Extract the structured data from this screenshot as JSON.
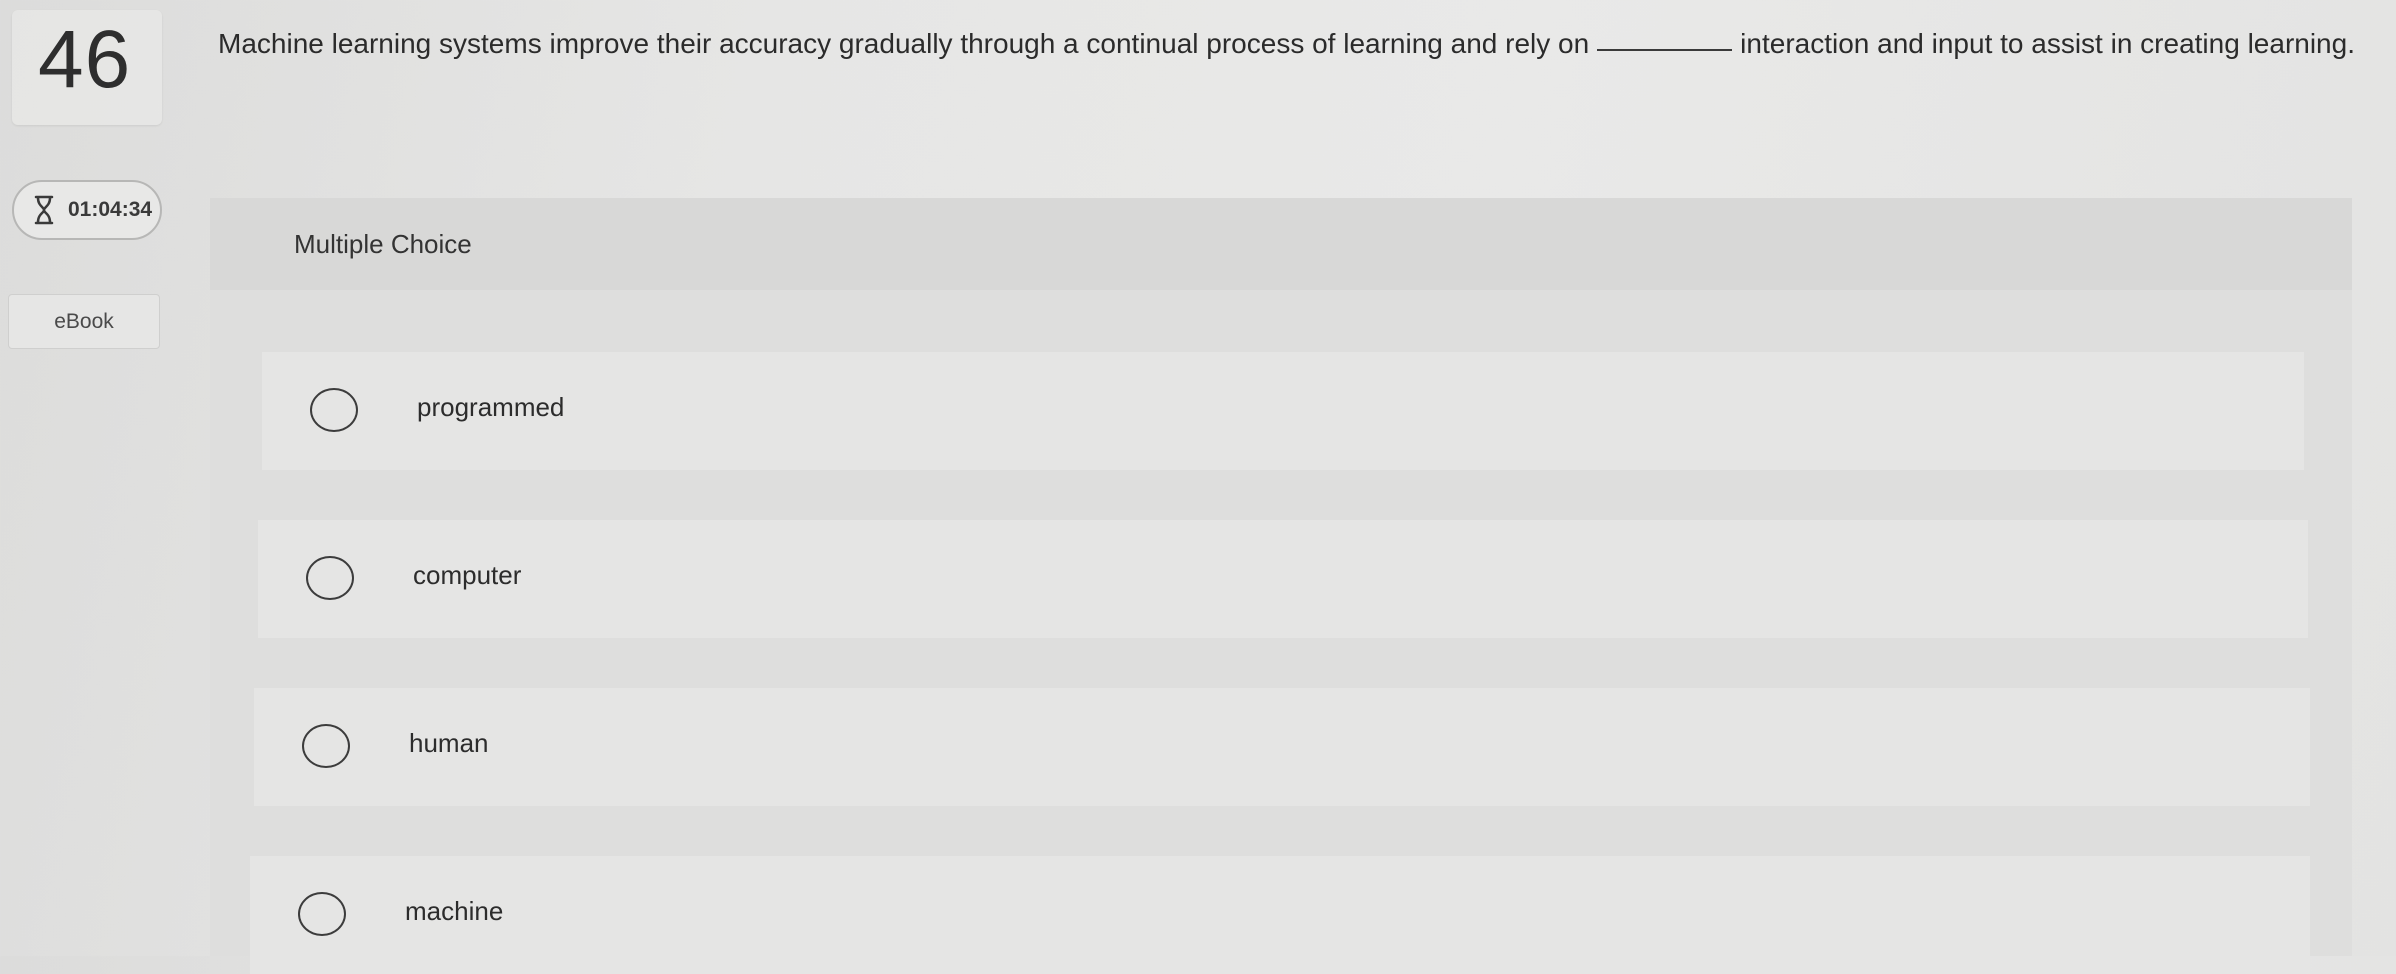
{
  "question": {
    "number": "46",
    "text_before": "Machine learning systems improve their accuracy gradually through a continual process of learning and rely on",
    "text_after": "interaction and input to assist in creating learning."
  },
  "sidebar": {
    "timer": "01:04:34",
    "ebook_label": "eBook"
  },
  "choices_panel": {
    "title": "Multiple Choice",
    "options": [
      {
        "label": "programmed",
        "selected": false
      },
      {
        "label": "computer",
        "selected": false
      },
      {
        "label": "human",
        "selected": false
      },
      {
        "label": "machine",
        "selected": false
      }
    ]
  },
  "icons": {
    "timer": "hourglass-icon",
    "option": "radio-button"
  }
}
